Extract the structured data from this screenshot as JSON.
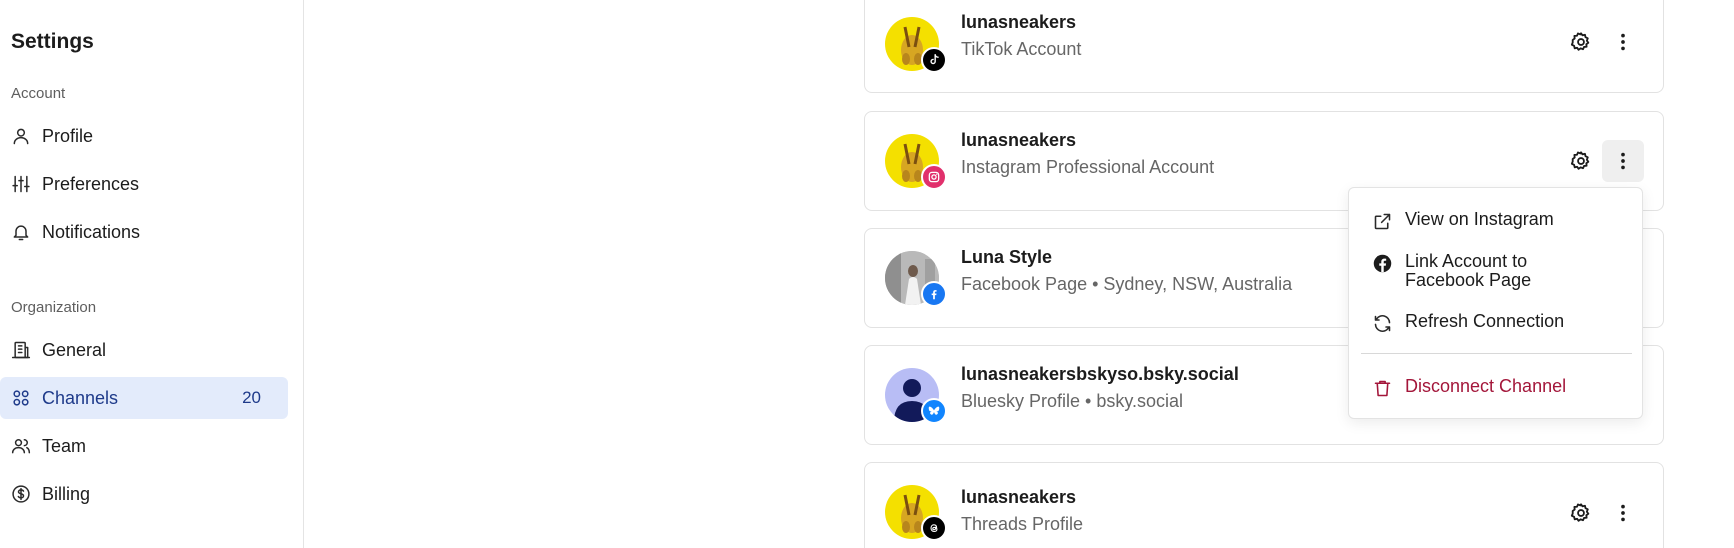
{
  "sidebar": {
    "title": "Settings",
    "sections": [
      {
        "label": "Account",
        "items": [
          {
            "label": "Profile",
            "icon": "user-icon"
          },
          {
            "label": "Preferences",
            "icon": "sliders-icon"
          },
          {
            "label": "Notifications",
            "icon": "bell-icon"
          }
        ]
      },
      {
        "label": "Organization",
        "items": [
          {
            "label": "General",
            "icon": "building-icon"
          },
          {
            "label": "Channels",
            "icon": "grid-icon",
            "count": "20",
            "active": true
          },
          {
            "label": "Team",
            "icon": "users-icon"
          },
          {
            "label": "Billing",
            "icon": "dollar-circle-icon"
          }
        ]
      }
    ]
  },
  "channels": [
    {
      "name": "lunasneakers",
      "subtitle": "TikTok Account",
      "platform": "tiktok",
      "badge_color": "#000000"
    },
    {
      "name": "lunasneakers",
      "subtitle": "Instagram Professional Account",
      "platform": "instagram",
      "badge_color": "#e1306c"
    },
    {
      "name": "Luna Style",
      "subtitle": "Facebook Page • Sydney, NSW, Australia",
      "platform": "facebook",
      "badge_color": "#1877f2"
    },
    {
      "name": "lunasneakersbskyso.bsky.social",
      "subtitle": "Bluesky Profile • bsky.social",
      "platform": "bluesky",
      "badge_color": "#1185fe"
    },
    {
      "name": "lunasneakers",
      "subtitle": "Threads Profile",
      "platform": "threads",
      "badge_color": "#000000"
    }
  ],
  "menu": {
    "items": [
      {
        "label": "View on Instagram",
        "icon": "external-link-icon"
      },
      {
        "label": "Link Account to Facebook Page",
        "icon": "facebook-icon"
      },
      {
        "label": "Refresh Connection",
        "icon": "refresh-icon"
      },
      {
        "label": "Disconnect Channel",
        "icon": "trash-icon",
        "danger": true
      }
    ]
  },
  "colors": {
    "active_bg": "#e3ebfb",
    "active_text": "#1e3a8a",
    "danger": "#a3163a"
  }
}
